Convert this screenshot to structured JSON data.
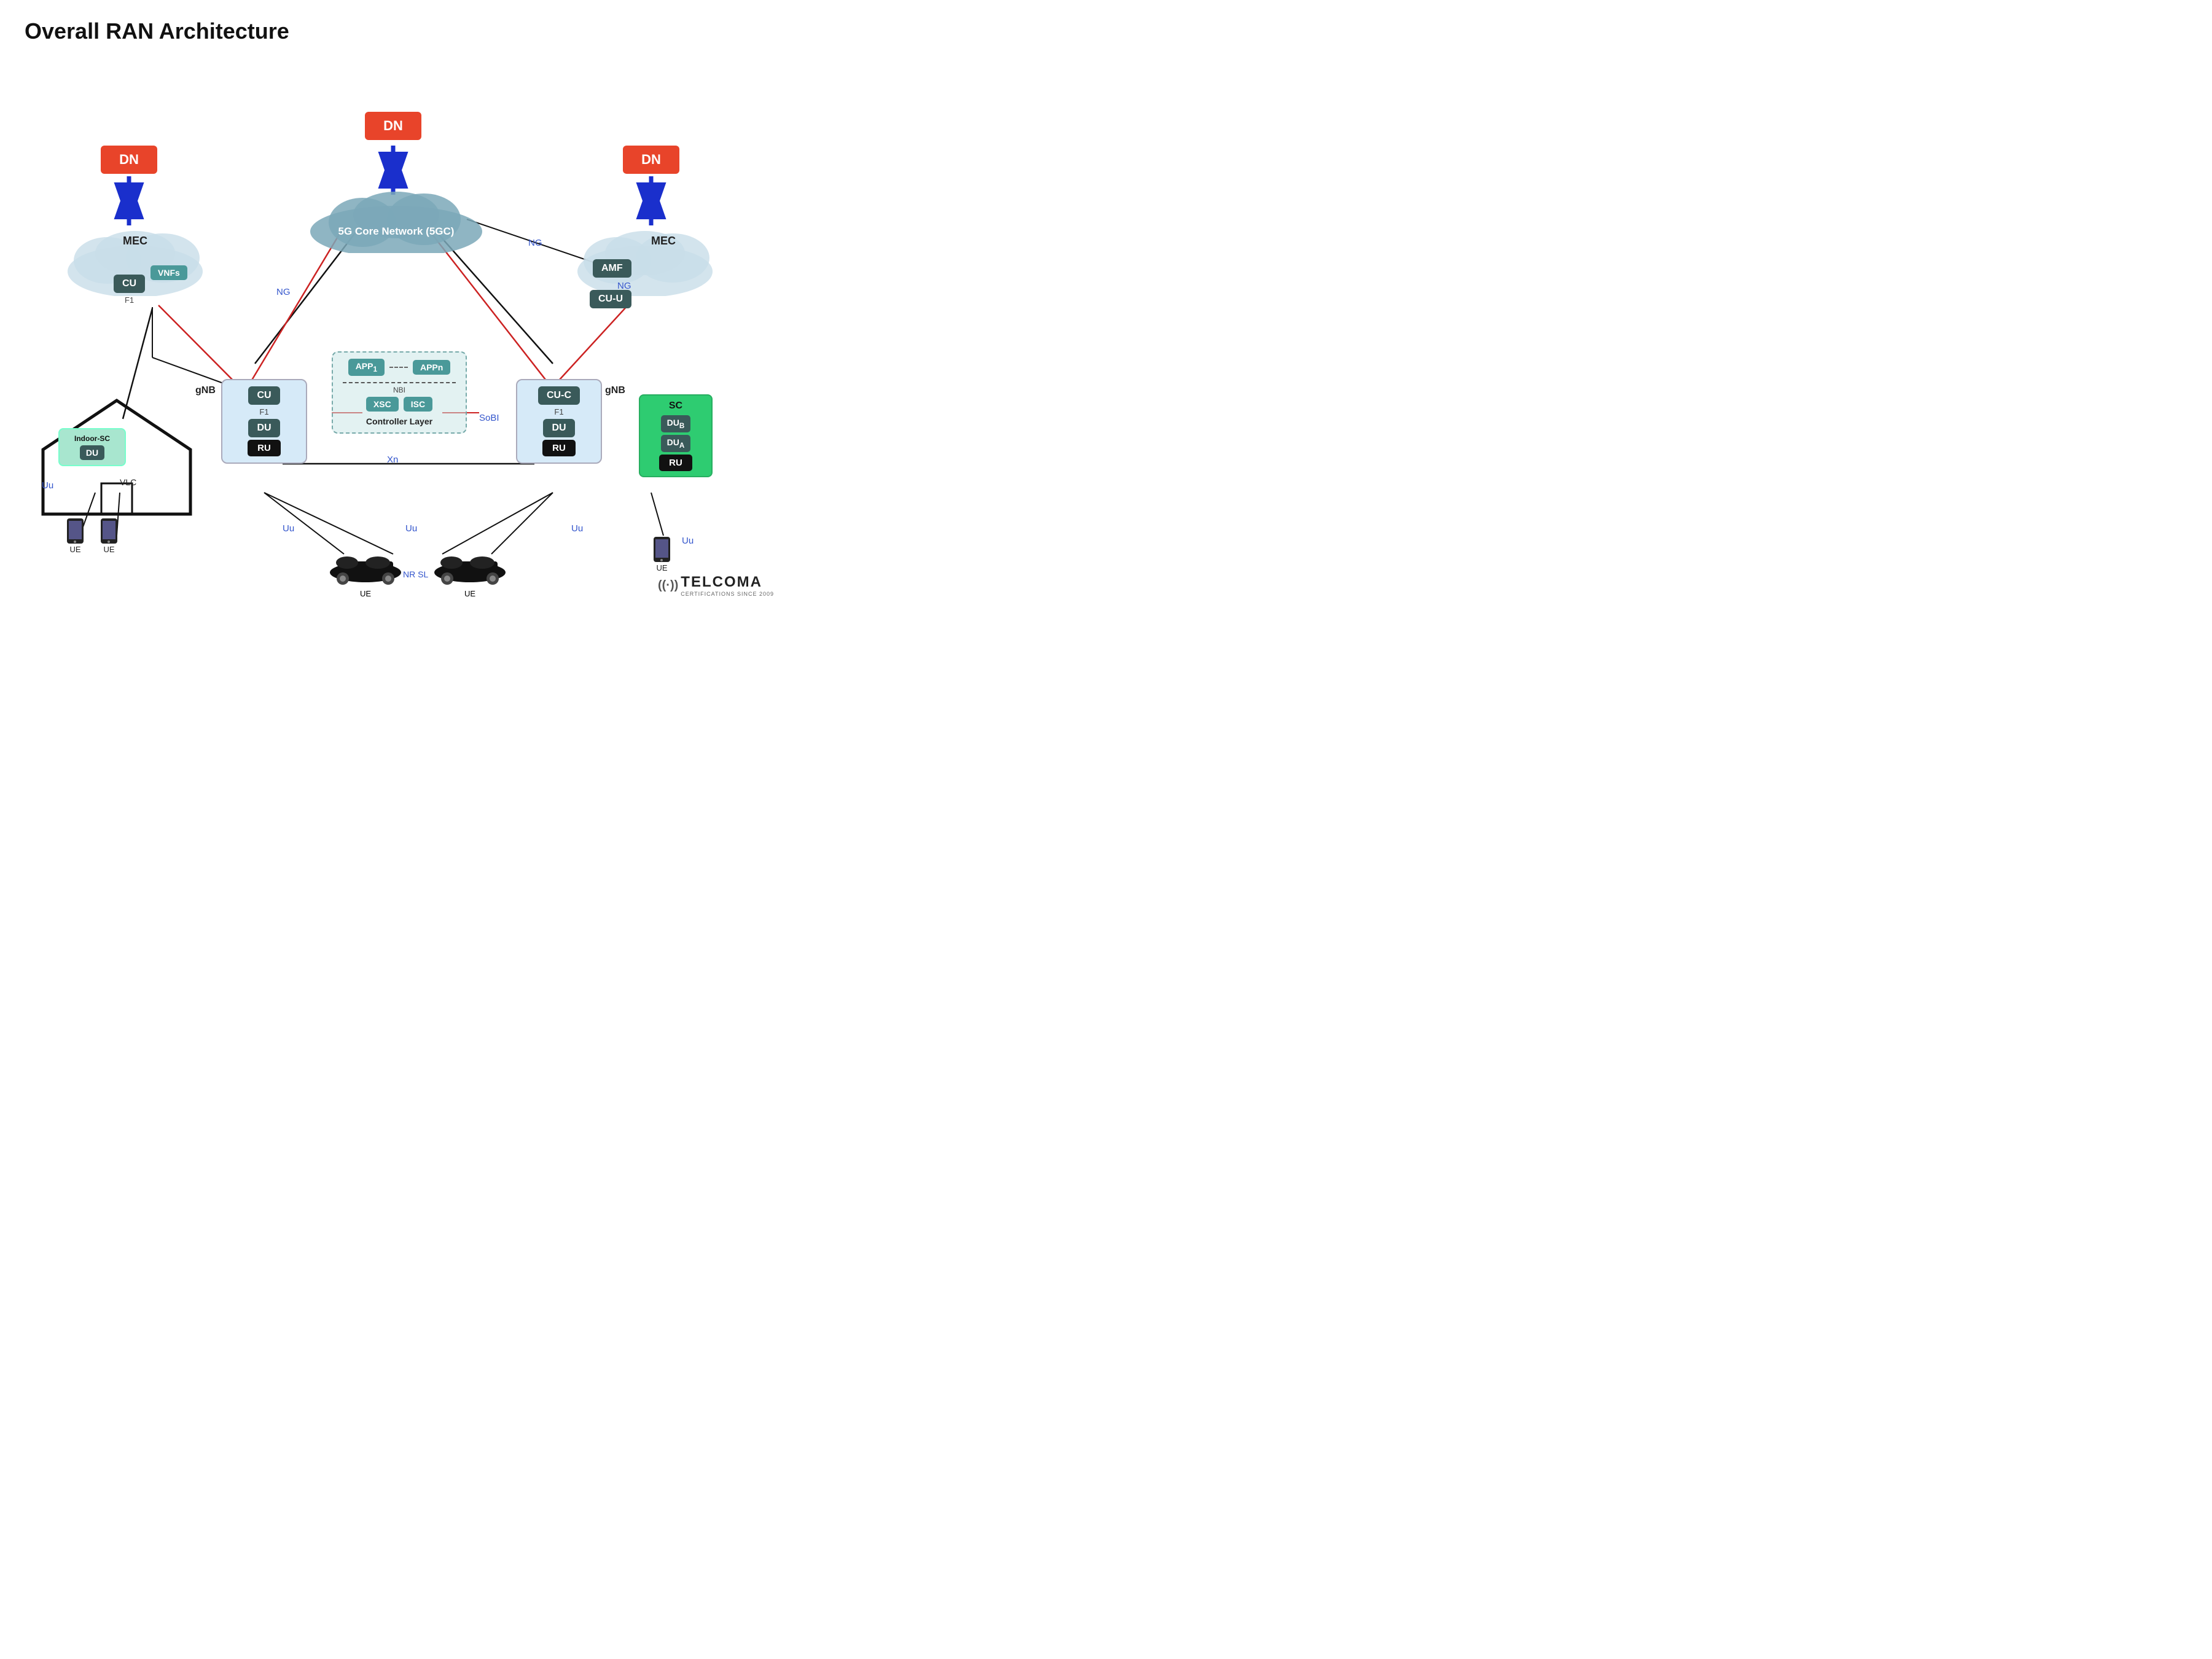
{
  "title": "Overall RAN Architecture",
  "nodes": {
    "dn_left": "DN",
    "dn_center": "DN",
    "dn_right": "DN",
    "core": "5G Core Network (5GC)",
    "mec_left": "MEC",
    "mec_right": "MEC",
    "cu_left": "CU",
    "cu_right_c": "CU-C",
    "cu_right_u": "CU-U",
    "cu_mec": "CU",
    "amf": "AMF",
    "vnfs": "VNFs",
    "du_left": "DU",
    "du_right": "DU",
    "du_indoor": "DU",
    "du_b": "DU",
    "du_a": "DU",
    "ru_left": "RU",
    "ru_right": "RU",
    "ru_sc": "RU",
    "gnb_left": "gNB",
    "gnb_right": "gNB",
    "sc": "SC",
    "indoor_sc": "Indoor-SC",
    "app1": "APP",
    "appn": "APPn",
    "nbi": "NBI",
    "xsc": "XSC",
    "isc": "ISC",
    "controller_layer": "Controller Layer",
    "ue1": "UE",
    "ue2": "UE",
    "ue3": "UE",
    "ue4": "UE",
    "ue5": "UE"
  },
  "labels": {
    "ng": "NG",
    "f1": "F1",
    "xn": "Xn",
    "uu": "Uu",
    "sobi": "SoBI",
    "sobi2": "SoBI",
    "nr_sl": "NR SL",
    "vlc": "VLC",
    "app1_sub": "1",
    "dub_sub": "B",
    "dua_sub": "A"
  },
  "telcoma": {
    "brand": "TELCOMA",
    "sub": "CERTIFICATIONS SINCE 2009"
  }
}
